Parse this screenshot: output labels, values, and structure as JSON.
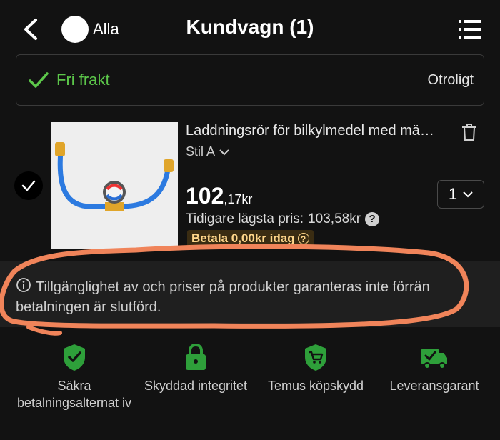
{
  "header": {
    "title": "Kundvagn (1)",
    "select_all_label": "Alla"
  },
  "shipping": {
    "label": "Fri frakt",
    "right_text": "Otroligt"
  },
  "item": {
    "title": "Laddningsrör för bilkylmedel med mä…",
    "variant": "Stil A",
    "price_main": "102",
    "price_sub": ",17kr",
    "quantity": "1",
    "previous_label": "Tidigare lägsta pris:",
    "previous_price": "103,58kr",
    "pay_today": "Betala 0,00kr idag"
  },
  "notice": {
    "text": "Tillgänglighet av och priser på produkter garanteras inte förrän betalningen är slutförd."
  },
  "trust": [
    {
      "label": "Säkra betalningsalternat iv",
      "icon": "shield-check-icon"
    },
    {
      "label": "Skyddad integritet",
      "icon": "lock-icon"
    },
    {
      "label": "Temus köpskydd",
      "icon": "cart-shield-icon"
    },
    {
      "label": "Leveransgarant",
      "icon": "truck-check-icon"
    }
  ],
  "colors": {
    "background": "#121212",
    "accent_green": "#5cc74a",
    "annotation_orange": "#f0845a"
  }
}
